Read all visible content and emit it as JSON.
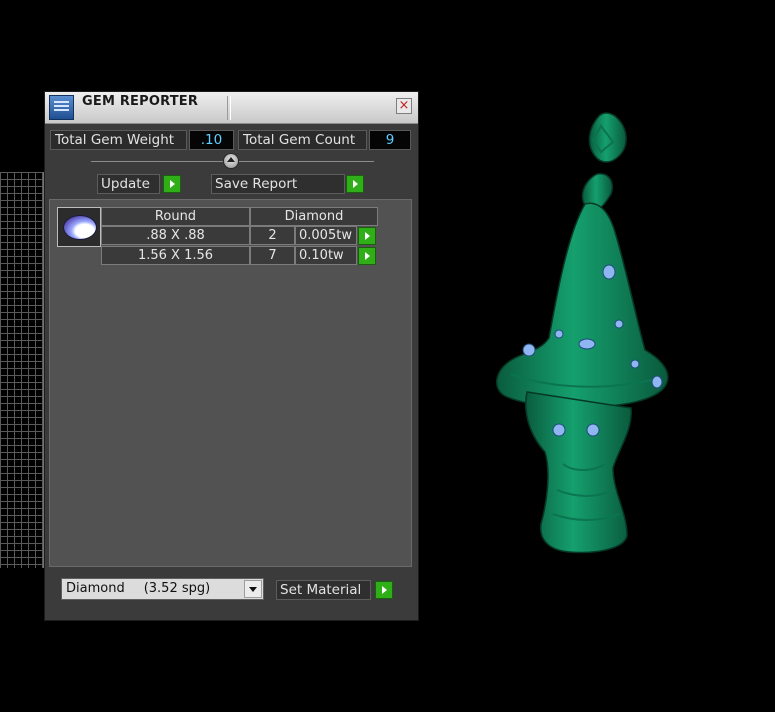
{
  "window": {
    "title": "GEM REPORTER",
    "close_label": "×"
  },
  "stats": {
    "total_weight_label": "Total Gem Weight",
    "total_weight_value": ".10",
    "total_count_label": "Total Gem Count",
    "total_count_value": "9"
  },
  "actions": {
    "update_label": "Update",
    "save_report_label": "Save Report"
  },
  "gem_table": {
    "shape": "Round",
    "material": "Diamond",
    "rows": [
      {
        "size": ".88 X .88",
        "count": "2",
        "weight": "0.005tw"
      },
      {
        "size": "1.56 X 1.56",
        "count": "7",
        "weight": "0.10tw"
      }
    ]
  },
  "material_select": {
    "name": "Diamond",
    "density": "(3.52 spg)"
  },
  "set_material_label": "Set Material",
  "colors": {
    "accent_green": "#2fae18",
    "value_cyan": "#5fd0ff",
    "model_green": "#0f8a5f",
    "gem_blue": "#8fb6f0"
  },
  "icons": [
    "gem-reporter-app-icon",
    "close-icon",
    "slider-knob-icon",
    "play-arrow-icon",
    "round-gem-icon",
    "dropdown-arrow-icon"
  ]
}
